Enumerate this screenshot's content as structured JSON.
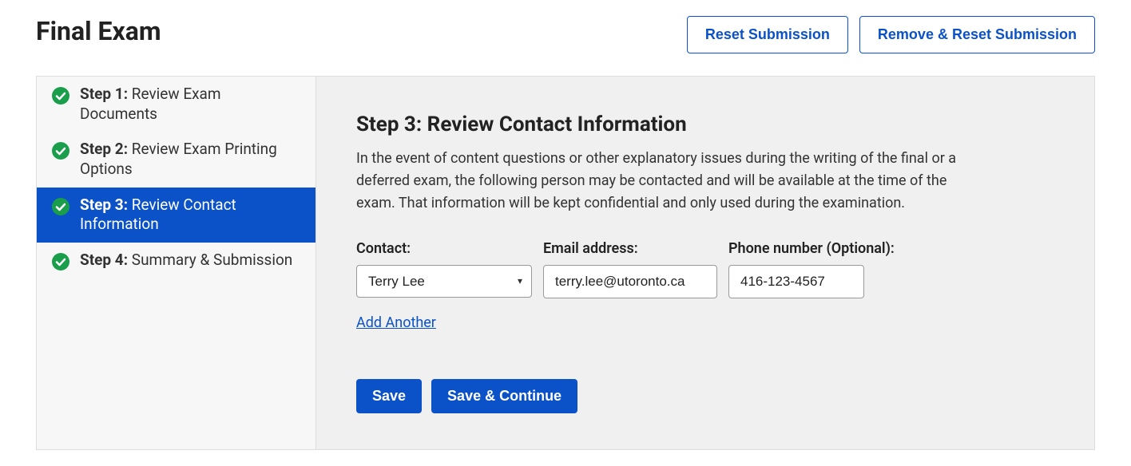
{
  "header": {
    "title": "Final Exam",
    "reset_label": "Reset Submission",
    "remove_reset_label": "Remove & Reset Submission"
  },
  "sidebar": {
    "items": [
      {
        "step": "Step 1:",
        "title": "Review Exam Documents"
      },
      {
        "step": "Step 2:",
        "title": "Review Exam Printing Options"
      },
      {
        "step": "Step 3:",
        "title": "Review Contact Information"
      },
      {
        "step": "Step 4:",
        "title": "Summary & Submission"
      }
    ]
  },
  "content": {
    "step_label": "Step 3:",
    "title": "Review Contact Information",
    "description": "In the event of content questions or other explanatory issues during the writing of the final or a deferred exam, the following person may be contacted and will be available at the time of the exam. That information will be kept confidential and only used during the examination.",
    "contact_label": "Contact:",
    "email_label": "Email address:",
    "phone_label": "Phone number (Optional):",
    "contact_value": "Terry Lee",
    "email_value": "terry.lee@utoronto.ca",
    "phone_value": "416-123-4567",
    "add_another": "Add Another",
    "save_label": "Save",
    "save_continue_label": "Save & Continue"
  }
}
